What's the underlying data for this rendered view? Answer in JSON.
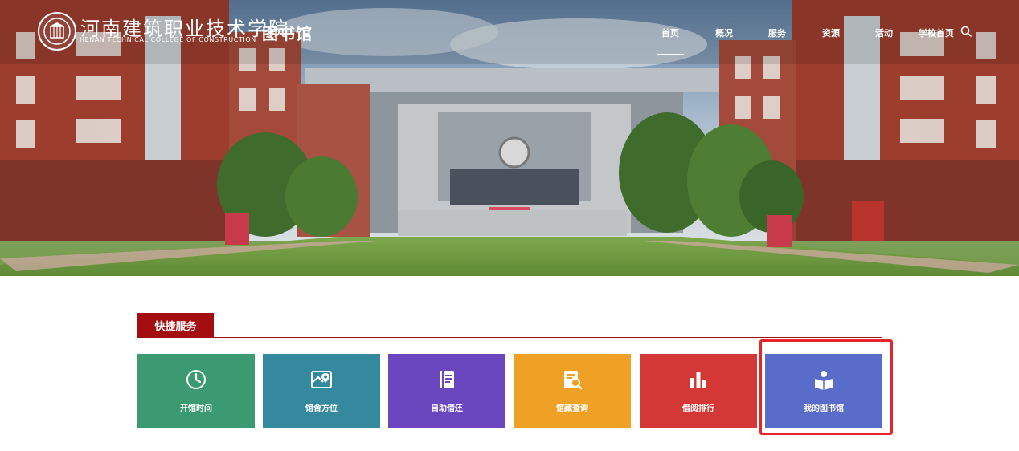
{
  "header": {
    "logo_cn": "河南建筑职业技术学院",
    "logo_en": "HENAN TECHNICAL COLLEGE OF CONSTRUCTION",
    "site_title": "图书馆",
    "nav": [
      {
        "label": "首页",
        "active": true
      },
      {
        "label": "概况"
      },
      {
        "label": "服务"
      },
      {
        "label": "资源"
      },
      {
        "label": "活动"
      },
      {
        "label": "学校首页"
      }
    ]
  },
  "quick_services": {
    "title": "快捷服务",
    "tiles": [
      {
        "label": "开馆时间",
        "icon": "clock-icon",
        "color": "#3b9a6f"
      },
      {
        "label": "馆舍方位",
        "icon": "map-location-icon",
        "color": "#35899e"
      },
      {
        "label": "自助借还",
        "icon": "book-icon",
        "color": "#6b47bf"
      },
      {
        "label": "馆藏查询",
        "icon": "document-search-icon",
        "color": "#eea124"
      },
      {
        "label": "借阅排行",
        "icon": "bar-chart-icon",
        "color": "#d33836"
      },
      {
        "label": "我的图书馆",
        "icon": "reader-icon",
        "color": "#5a6cc9"
      }
    ]
  },
  "colors": {
    "accent_red": "#a50e10",
    "highlight_red": "#e5252a"
  }
}
